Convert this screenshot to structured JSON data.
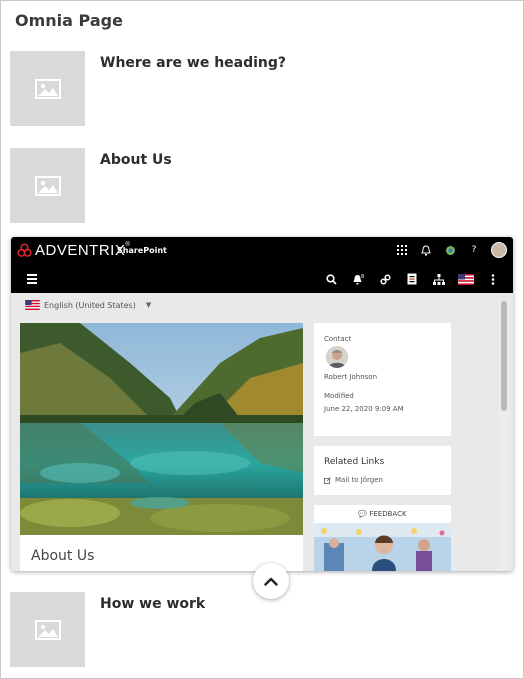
{
  "page": {
    "title": "Omnia Page"
  },
  "items": [
    {
      "title": "Where are we heading?",
      "thumb_icon": "image-placeholder-icon"
    },
    {
      "title": "About Us",
      "thumb_icon": "image-placeholder-icon"
    },
    {
      "title": "How we work",
      "thumb_icon": "image-placeholder-icon"
    }
  ],
  "preview": {
    "brand": "ADVENTRIX",
    "brand_mark": "®",
    "product": "SharePoint",
    "top_icons": [
      "app-launcher-icon",
      "bell-icon",
      "globe-icon",
      "help-icon",
      "user-avatar"
    ],
    "nav_icons": [
      "search-icon",
      "notification-icon",
      "link-icon",
      "document-icon",
      "sitemap-icon",
      "us-flag-icon",
      "more-icon"
    ],
    "language": "English (United States)",
    "about_title": "About Us",
    "contact": {
      "label": "Contact",
      "name": "Robert Johnson",
      "modified_label": "Modified",
      "modified_value": "June 22, 2020 9:09 AM"
    },
    "related_links": {
      "title": "Related Links",
      "items": [
        "Mail to Jörgen"
      ]
    },
    "feedback_label": "FEEDBACK"
  },
  "colors": {
    "topbar": "#000000",
    "placeholder": "#d9d9d9",
    "card_bg": "#e9e9e9"
  }
}
